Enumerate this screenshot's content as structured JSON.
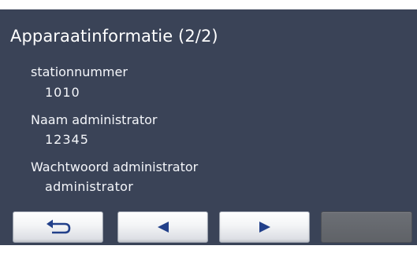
{
  "title": "Apparaatinformatie (2/2)",
  "fields": [
    {
      "label": "stationnummer",
      "value": "1010"
    },
    {
      "label": "Naam administrator",
      "value": "12345"
    },
    {
      "label": "Wachtwoord administrator",
      "value": "administrator"
    }
  ],
  "buttons": {
    "back": {
      "icon": "return-arrow-icon"
    },
    "previous": {
      "icon": "triangle-left-icon"
    },
    "next": {
      "icon": "triangle-right-icon"
    },
    "blank": {
      "enabled": false
    }
  },
  "colors": {
    "screen_background": "#3a4357",
    "text": "#ffffff",
    "icon": "#22408a",
    "disabled_button": "#646870"
  }
}
